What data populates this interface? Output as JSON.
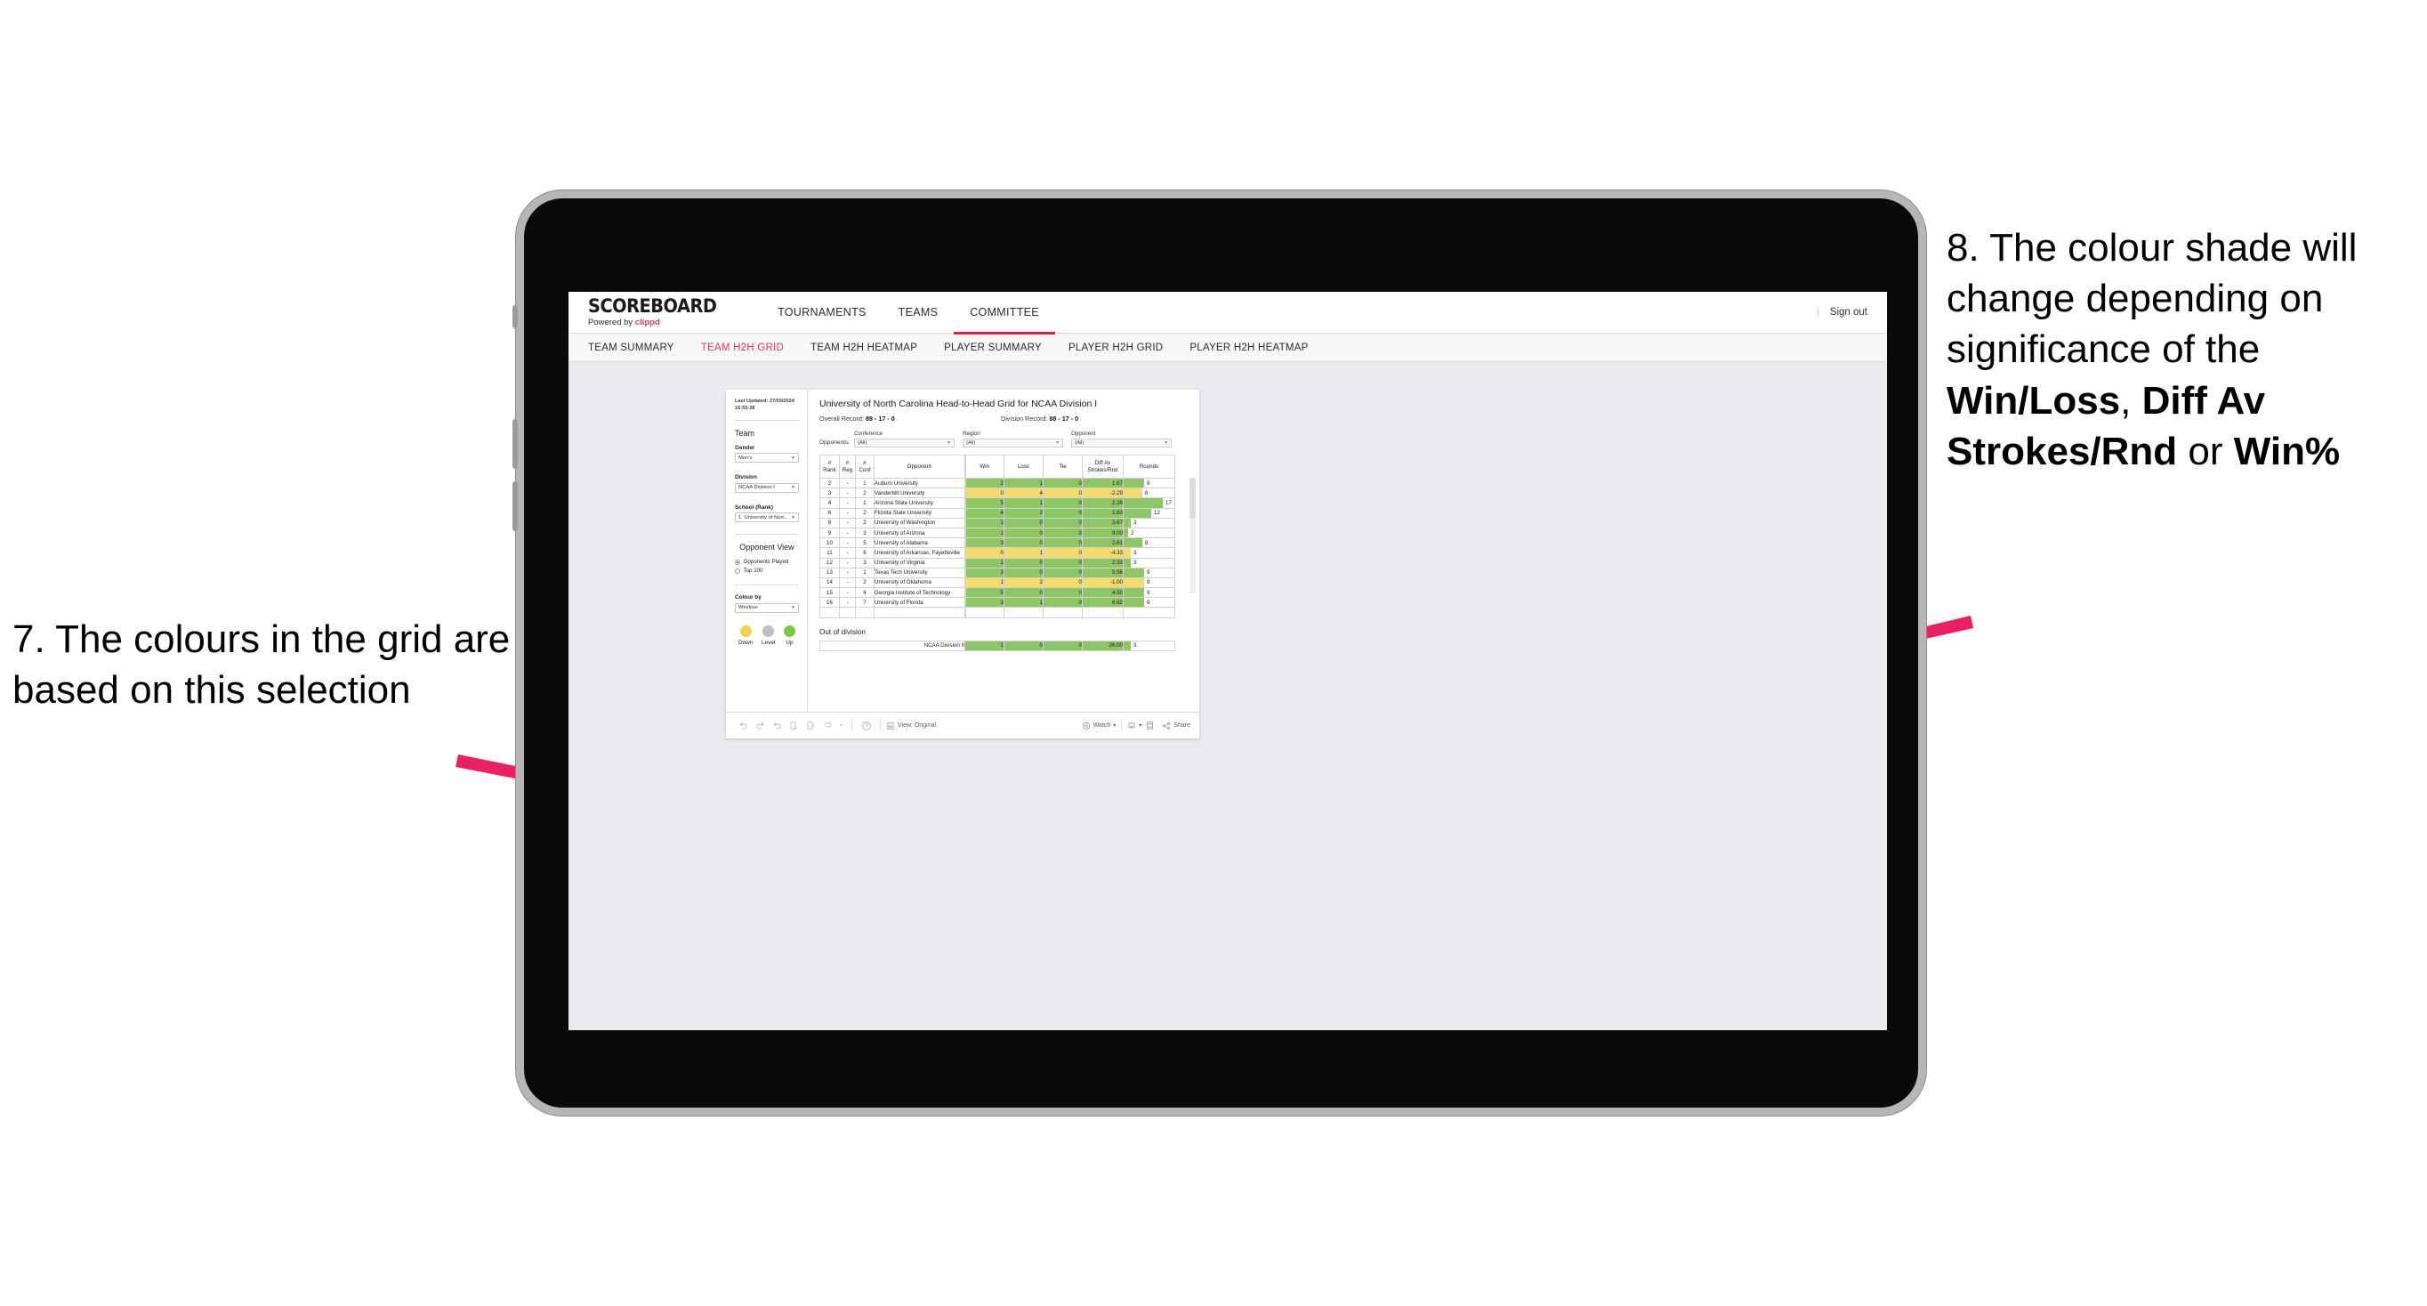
{
  "annotations": {
    "left": {
      "text": "7. The colours in the grid are based on this selection",
      "arrow_color": "#ec1f63"
    },
    "right": {
      "number": "8. ",
      "line1": "The colour shade will change depending on significance of the ",
      "bold1": "Win/Loss",
      "mid1": ", ",
      "bold2": "Diff Av Strokes/Rnd",
      "mid2": " or ",
      "bold3": "Win%",
      "arrow_color": "#ec1f63"
    }
  },
  "header": {
    "logo": "SCOREBOARD",
    "logo_sub_prefix": "Powered by ",
    "logo_sub_brand": "clippd",
    "nav": [
      {
        "label": "TOURNAMENTS",
        "active": false
      },
      {
        "label": "TEAMS",
        "active": false
      },
      {
        "label": "COMMITTEE",
        "active": true
      }
    ],
    "sign_out": "Sign out",
    "accent": "#d81f4a"
  },
  "subnav": {
    "items": [
      {
        "label": "TEAM SUMMARY",
        "active": false
      },
      {
        "label": "TEAM H2H GRID",
        "active": true
      },
      {
        "label": "TEAM H2H HEATMAP",
        "active": false
      },
      {
        "label": "PLAYER SUMMARY",
        "active": false
      },
      {
        "label": "PLAYER H2H GRID",
        "active": false
      },
      {
        "label": "PLAYER H2H HEATMAP",
        "active": false
      }
    ]
  },
  "panel": {
    "last_updated": "Last Updated: 27/03/2024 16:55:38",
    "team_heading": "Team",
    "gender_label": "Gender",
    "gender_value": "Men's",
    "division_label": "Division",
    "division_value": "NCAA Division I",
    "school_label": "School (Rank)",
    "school_value": "1. University of Nort...",
    "opponent_view_heading": "Opponent View",
    "radios": [
      {
        "label": "Opponents Played",
        "selected": true
      },
      {
        "label": "Top 100",
        "selected": false
      }
    ],
    "colour_by_label": "Colour by",
    "colour_by_value": "Win/loss",
    "legend": [
      {
        "label": "Down",
        "color": "#f2d14d"
      },
      {
        "label": "Level",
        "color": "#bfbfbf"
      },
      {
        "label": "Up",
        "color": "#7ac943"
      }
    ]
  },
  "content": {
    "title": "University of North Carolina Head-to-Head Grid for NCAA Division I",
    "overall_record_label": "Overall Record: ",
    "overall_record_value": "89 - 17 - 0",
    "division_record_label": "Division Record: ",
    "division_record_value": "88 - 17 - 0",
    "opponents_lead": "Opponents:",
    "filters": [
      {
        "label": "Conference",
        "value": "(All)"
      },
      {
        "label": "Region",
        "value": "(All)"
      },
      {
        "label": "Opponent",
        "value": "(All)"
      }
    ],
    "out_of_division_title": "Out of division"
  },
  "chart_data": {
    "type": "table",
    "title": "University of North Carolina Head-to-Head Grid for NCAA Division I",
    "columns": [
      "# Rank",
      "# Reg",
      "# Conf",
      "Opponent",
      "Win",
      "Loss",
      "Tie",
      "Diff Av Strokes/Rnd",
      "Rounds"
    ],
    "column_header_lines": [
      [
        "#",
        "Rank"
      ],
      [
        "#",
        "Reg"
      ],
      [
        "#",
        "Conf"
      ],
      [
        "Opponent"
      ],
      [
        "Win"
      ],
      [
        "Loss"
      ],
      [
        "Tie"
      ],
      [
        "Diff Av",
        "Strokes/Rnd"
      ],
      [
        "Rounds"
      ]
    ],
    "colour_scale": {
      "up": "#8dc765",
      "down": "#f5dc6a",
      "level": "#bfbfbf"
    },
    "rounds_max": 17,
    "rows": [
      {
        "rank": "2",
        "reg": "-",
        "conf": "1",
        "opponent": "Auburn University",
        "win": "2",
        "loss": "1",
        "tie": "0",
        "diff": "1.67",
        "rounds": 9,
        "state": "up"
      },
      {
        "rank": "3",
        "reg": "-",
        "conf": "2",
        "opponent": "Vanderbilt University",
        "win": "0",
        "loss": "4",
        "tie": "0",
        "diff": "-2.29",
        "rounds": 8,
        "state": "down"
      },
      {
        "rank": "4",
        "reg": "-",
        "conf": "1",
        "opponent": "Arizona State University",
        "win": "5",
        "loss": "1",
        "tie": "0",
        "diff": "2.28",
        "rounds": 17,
        "state": "up"
      },
      {
        "rank": "6",
        "reg": "-",
        "conf": "2",
        "opponent": "Florida State University",
        "win": "4",
        "loss": "2",
        "tie": "0",
        "diff": "1.83",
        "rounds": 12,
        "state": "up"
      },
      {
        "rank": "8",
        "reg": "-",
        "conf": "2",
        "opponent": "University of Washington",
        "win": "1",
        "loss": "0",
        "tie": "0",
        "diff": "3.67",
        "rounds": 3,
        "state": "up"
      },
      {
        "rank": "9",
        "reg": "-",
        "conf": "3",
        "opponent": "University of Arizona",
        "win": "1",
        "loss": "0",
        "tie": "0",
        "diff": "9.00",
        "rounds": 2,
        "state": "up"
      },
      {
        "rank": "10",
        "reg": "-",
        "conf": "5",
        "opponent": "University of Alabama",
        "win": "3",
        "loss": "0",
        "tie": "0",
        "diff": "2.61",
        "rounds": 8,
        "state": "up"
      },
      {
        "rank": "11",
        "reg": "-",
        "conf": "6",
        "opponent": "University of Arkansas, Fayetteville",
        "win": "0",
        "loss": "1",
        "tie": "0",
        "diff": "-4.33",
        "rounds": 3,
        "state": "down"
      },
      {
        "rank": "12",
        "reg": "-",
        "conf": "3",
        "opponent": "University of Virginia",
        "win": "1",
        "loss": "0",
        "tie": "0",
        "diff": "2.33",
        "rounds": 3,
        "state": "up"
      },
      {
        "rank": "13",
        "reg": "-",
        "conf": "1",
        "opponent": "Texas Tech University",
        "win": "3",
        "loss": "0",
        "tie": "0",
        "diff": "5.56",
        "rounds": 9,
        "state": "up"
      },
      {
        "rank": "14",
        "reg": "-",
        "conf": "2",
        "opponent": "University of Oklahoma",
        "win": "1",
        "loss": "2",
        "tie": "0",
        "diff": "-1.00",
        "rounds": 9,
        "state": "down"
      },
      {
        "rank": "15",
        "reg": "-",
        "conf": "4",
        "opponent": "Georgia Institute of Technology",
        "win": "5",
        "loss": "0",
        "tie": "0",
        "diff": "4.50",
        "rounds": 9,
        "state": "up"
      },
      {
        "rank": "16",
        "reg": "-",
        "conf": "7",
        "opponent": "University of Florida",
        "win": "3",
        "loss": "1",
        "tie": "0",
        "diff": "6.62",
        "rounds": 9,
        "state": "up"
      }
    ],
    "out_of_division_rows": [
      {
        "opponent": "NCAA Division II",
        "win": "1",
        "loss": "0",
        "tie": "0",
        "diff": "26.00",
        "rounds": 3,
        "state": "up"
      }
    ]
  },
  "toolbar": {
    "view_label": "View: Original",
    "watch_label": "Watch",
    "share_label": "Share"
  }
}
